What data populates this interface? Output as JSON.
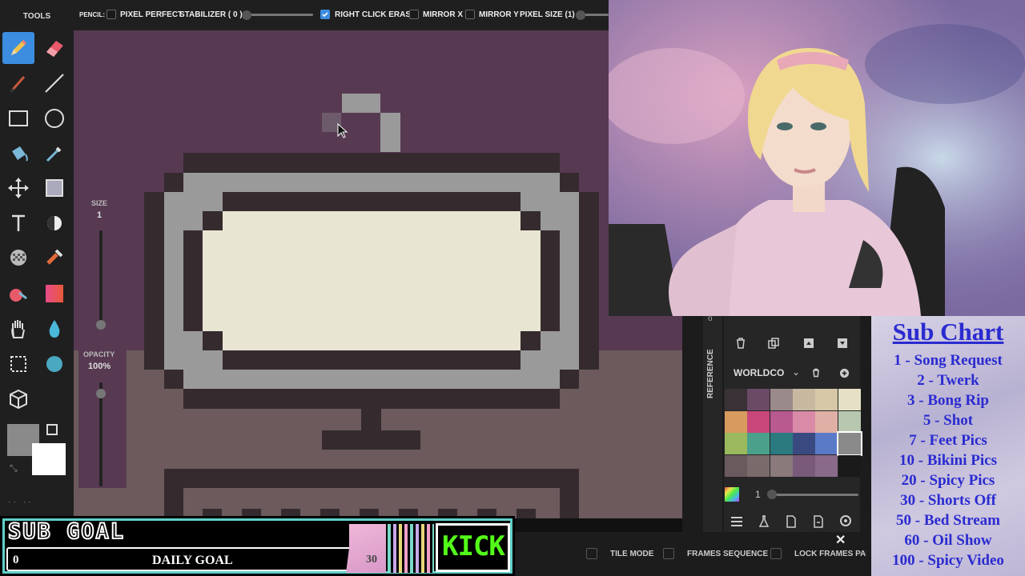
{
  "tools_title": "TOOLS",
  "toolbar": {
    "tool_name": "PENCIL:",
    "pixel_perfect": "PIXEL PERFECT",
    "pixel_perfect_checked": false,
    "stabilizer": "STABILIZER ( 0 )",
    "right_click_erase": "RIGHT CLICK ERASE",
    "right_click_erase_checked": true,
    "mirror_x": "MIRROR X",
    "mirror_y": "MIRROR Y",
    "pixel_size": "PIXEL SIZE (1)"
  },
  "size_panel": {
    "size_label": "SIZE",
    "size_value": "1",
    "opacity_label": "OPACITY",
    "opacity_value": "100%"
  },
  "layers": {
    "palette_name": "WORLDCO",
    "zoom_value": "1",
    "reference_label": "REFERENCE"
  },
  "bottom": {
    "tile_mode": "TILE MODE",
    "frames_sequence": "FRAMES SEQUENCE",
    "lock_frames_panel": "LOCK FRAMES PANEL"
  },
  "sub_chart": {
    "title": "Sub Chart",
    "items": [
      "1 - Song Request",
      "2 - Twerk",
      "3 - Bong Rip",
      "5 - Shot",
      "7 - Feet Pics",
      "10 - Bikini Pics",
      "20 - Spicy Pics",
      "30 - Shorts Off",
      "50 - Bed Stream",
      "60 - Oil Show",
      "100 - Spicy Video"
    ]
  },
  "sub_goal": {
    "title": "SUB GOAL",
    "current": "0",
    "label": "DAILY GOAL",
    "target": "30",
    "brand": "KICK",
    "progress": 0
  },
  "colors": {
    "accent": "#3c8de0",
    "canvas_bg": "#573a52",
    "sub_chart_text": "#2b2bd0",
    "kick_green": "#53fc18",
    "goal_border": "#5fd0c8",
    "palette": [
      "#3a3236",
      "#6b4a66",
      "#9a8a8c",
      "#c8b8a0",
      "#d6c8a6",
      "#e6e0c6",
      "#d89a5e",
      "#c8467a",
      "#b85a90",
      "#d88aa6",
      "#e0b0a6",
      "#b8c8b0",
      "#9ab85e",
      "#4aa08a",
      "#2a7a80",
      "#3a4a80",
      "#5a7ac8",
      "#8a8a8a",
      "#6a5a5e",
      "#7a6a6c",
      "#8a7a7c",
      "#7a5a7a",
      "#8a6a8a",
      "#1a1a1a"
    ],
    "palette_selected": 17
  }
}
